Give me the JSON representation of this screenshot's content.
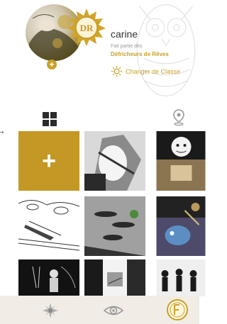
{
  "profile": {
    "username": "carine",
    "badge_initials": "DR",
    "member_of_label": "Fait partie des",
    "group_name": "Défricheurs de Rêves",
    "change_class_label": "Changer de Classe",
    "add_symbol": "+"
  },
  "tabs": {
    "grid_icon": "grid-icon",
    "map_icon": "location-pin-icon",
    "arrow": "→"
  },
  "gallery": {
    "add_label": "+",
    "items": [
      {
        "id": "add-tile"
      },
      {
        "id": "thumbnail-1"
      },
      {
        "id": "thumbnail-2"
      },
      {
        "id": "thumbnail-3"
      },
      {
        "id": "thumbnail-4"
      },
      {
        "id": "thumbnail-5"
      },
      {
        "id": "thumbnail-6"
      },
      {
        "id": "thumbnail-7"
      },
      {
        "id": "thumbnail-8"
      }
    ]
  },
  "bottom_nav": {
    "items": [
      "sun-icon",
      "eye-icon",
      "profile-badge-icon"
    ]
  },
  "colors": {
    "accent_gold": "#c39824",
    "bottom_bar": "#f1ede6"
  }
}
